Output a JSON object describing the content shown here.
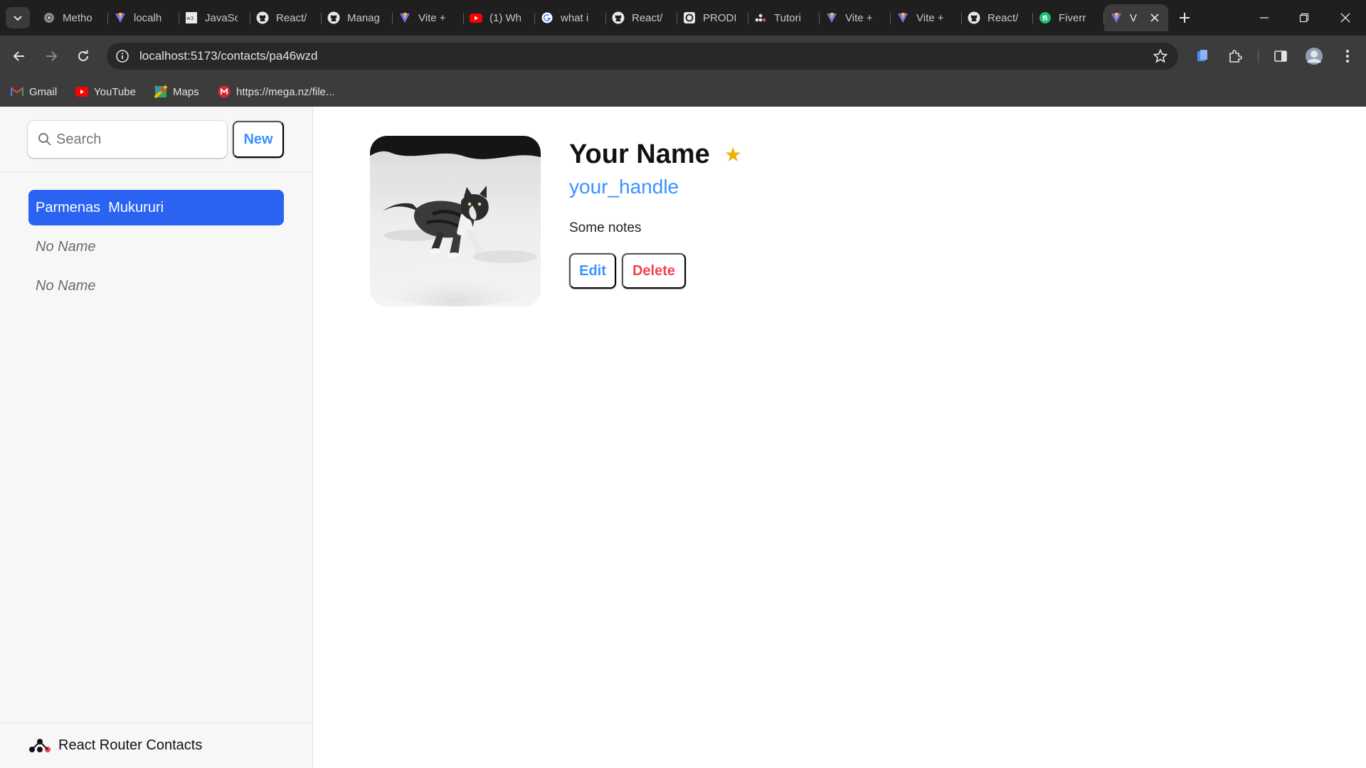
{
  "browser": {
    "tabs": [
      {
        "title": "Metho",
        "icon": "chromium-icon"
      },
      {
        "title": "localh",
        "icon": "vite-icon"
      },
      {
        "title": "JavaSc",
        "icon": "w3schools-icon"
      },
      {
        "title": "React/",
        "icon": "github-icon"
      },
      {
        "title": "Manag",
        "icon": "github-icon"
      },
      {
        "title": "Vite +",
        "icon": "vite-icon"
      },
      {
        "title": "(1) Wh",
        "icon": "youtube-icon"
      },
      {
        "title": "what i",
        "icon": "google-icon"
      },
      {
        "title": "React/",
        "icon": "github-icon"
      },
      {
        "title": "PRODI",
        "icon": "openai-icon"
      },
      {
        "title": "Tutori",
        "icon": "react-router-icon"
      },
      {
        "title": "Vite +",
        "icon": "vite-icon"
      },
      {
        "title": "Vite +",
        "icon": "vite-icon"
      },
      {
        "title": "React/",
        "icon": "github-icon"
      },
      {
        "title": "Fiverr",
        "icon": "fiverr-icon"
      }
    ],
    "active_tab": {
      "title": "V",
      "icon": "vite-icon"
    },
    "url": "localhost:5173/contacts/pa46wzd",
    "bookmarks": [
      {
        "label": "Gmail",
        "icon": "gmail-icon"
      },
      {
        "label": "YouTube",
        "icon": "youtube-icon"
      },
      {
        "label": "Maps",
        "icon": "maps-icon"
      },
      {
        "label": "https://mega.nz/file...",
        "icon": "mega-icon"
      }
    ]
  },
  "sidebar": {
    "search_placeholder": "Search",
    "new_label": "New",
    "contacts": [
      {
        "label": "Parmenas  Mukururi",
        "active": true,
        "noname": false
      },
      {
        "label": "No Name",
        "active": false,
        "noname": true
      },
      {
        "label": "No Name",
        "active": false,
        "noname": true
      }
    ],
    "footer_title": "React Router Contacts"
  },
  "contact": {
    "name": "Your Name",
    "favorite": "★",
    "handle": "your_handle",
    "notes": "Some notes",
    "edit_label": "Edit",
    "delete_label": "Delete",
    "avatar": "cat-in-snow-photo"
  },
  "colors": {
    "accent": "#3992ff",
    "active_contact": "#2a62f2",
    "delete": "#f44250",
    "star": "#eeb004"
  }
}
